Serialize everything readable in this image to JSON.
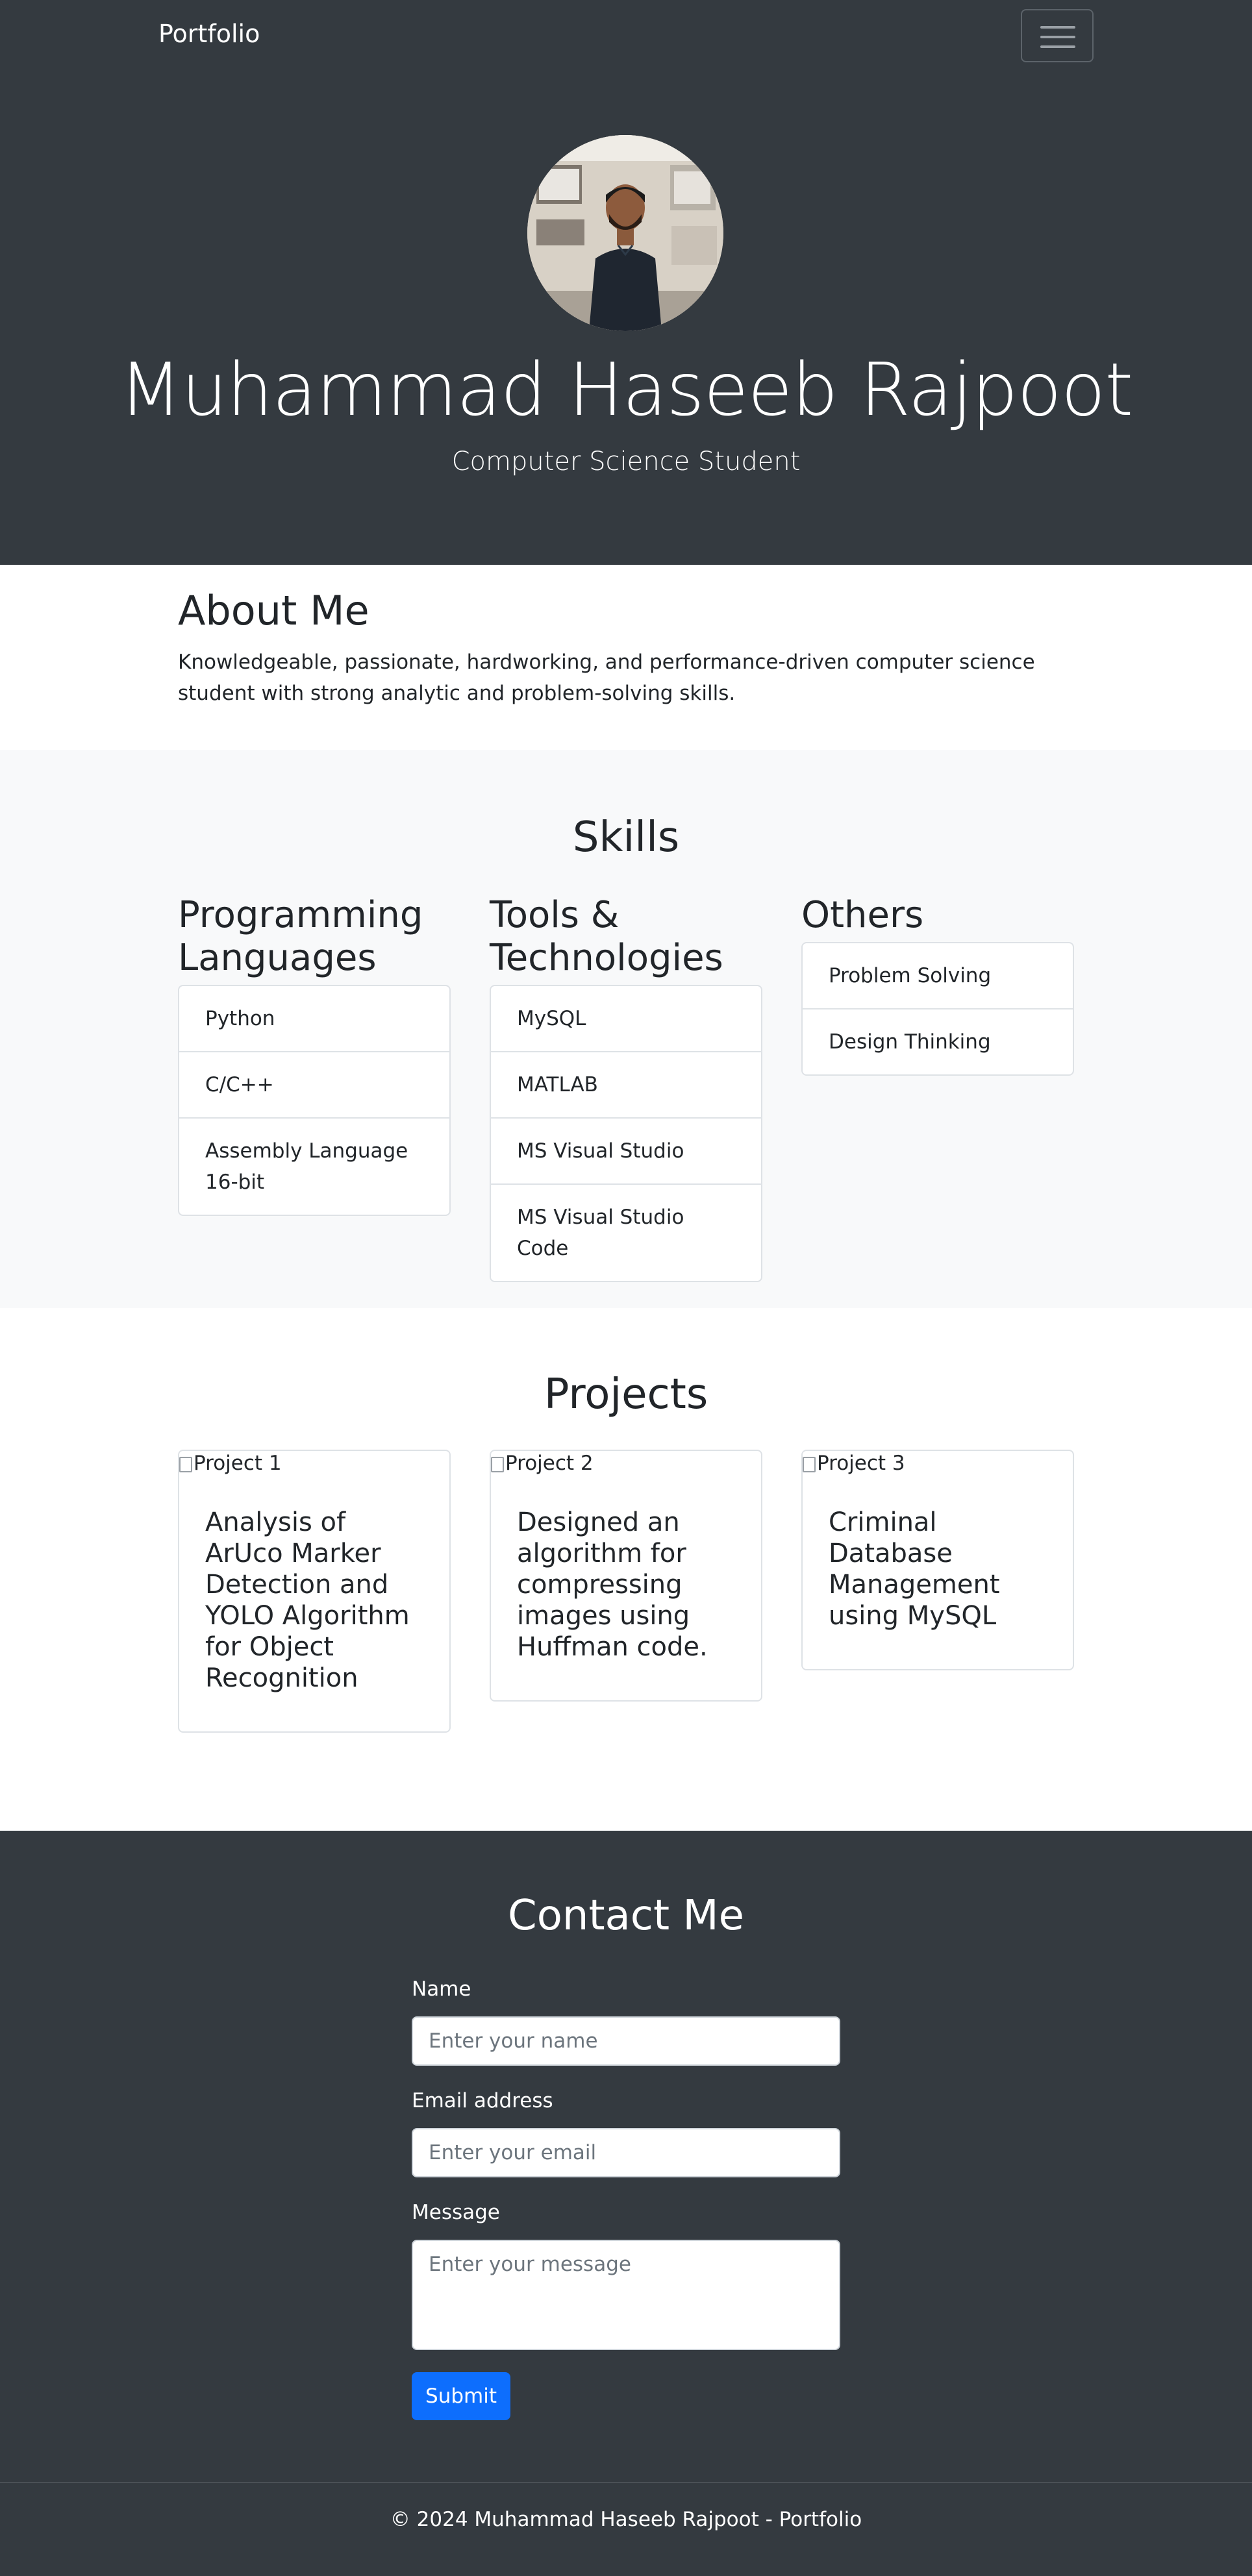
{
  "navbar": {
    "brand": "Portfolio",
    "toggler_icon": "hamburger-menu-icon"
  },
  "hero": {
    "name": "Muhammad Haseeb Rajpoot",
    "subtitle": "Computer Science Student"
  },
  "about": {
    "title": "About Me",
    "text": "Knowledgeable, passionate, hardworking, and performance-driven computer science student with strong analytic and problem-solving skills."
  },
  "skills": {
    "title": "Skills",
    "columns": [
      {
        "heading": "Programming Languages",
        "items": [
          "Python",
          "C/C++",
          "Assembly Language 16-bit"
        ]
      },
      {
        "heading": "Tools & Technologies",
        "items": [
          "MySQL",
          "MATLAB",
          "MS Visual Studio",
          "MS Visual Studio Code"
        ]
      },
      {
        "heading": "Others",
        "items": [
          "Problem Solving",
          "Design Thinking"
        ]
      }
    ]
  },
  "projects": {
    "title": "Projects",
    "cards": [
      {
        "img_alt": "Project 1",
        "title": "Analysis of ArUco Marker Detection and YOLO Algorithm for Object Recognition"
      },
      {
        "img_alt": "Project 2",
        "title": "Designed an algorithm for compressing images using Huffman code."
      },
      {
        "img_alt": "Project 3",
        "title": "Criminal Database Management using MySQL"
      }
    ]
  },
  "contact": {
    "title": "Contact Me",
    "name_label": "Name",
    "name_placeholder": "Enter your name",
    "email_label": "Email address",
    "email_placeholder": "Enter your email",
    "message_label": "Message",
    "message_placeholder": "Enter your message",
    "submit_label": "Submit"
  },
  "footer": {
    "text": "© 2024 Muhammad Haseeb Rajpoot - Portfolio"
  },
  "colors": {
    "dark": "#343a40",
    "light": "#f8f9fa",
    "primary": "#0d6efd"
  }
}
